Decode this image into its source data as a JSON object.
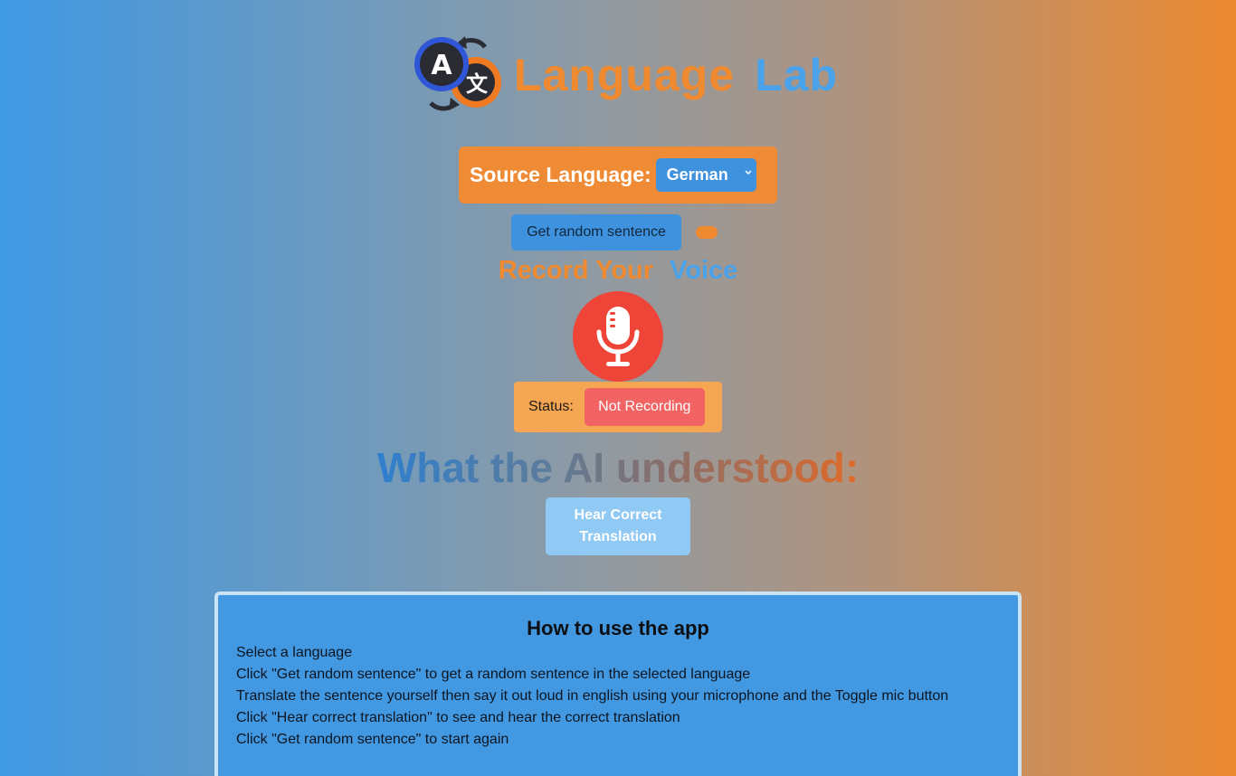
{
  "header": {
    "title_part1": "Language",
    "title_part2": "Lab",
    "logo_icon": "translate-logo-icon",
    "logo_letter_latin": "A",
    "logo_letter_cjk": "文"
  },
  "source": {
    "label": "Source Language:",
    "selected": "German"
  },
  "controls": {
    "random_label": "Get random sentence"
  },
  "record": {
    "title_part1": "Record Your",
    "title_part2": "Voice",
    "mic_icon": "microphone-icon"
  },
  "status": {
    "label": "Status:",
    "value": "Not Recording"
  },
  "result": {
    "title": "What the AI understood:"
  },
  "hear": {
    "label_line1": "Hear Correct",
    "label_line2": "Translation"
  },
  "howto": {
    "title": "How to use the app",
    "steps": [
      "Select a language",
      "Click \"Get random sentence\" to get a random sentence in the selected language",
      "Translate the sentence yourself then say it out loud in english using your microphone and the Toggle mic button",
      "Click \"Hear correct translation\" to see and hear the correct translation",
      "Click \"Get random sentence\" to start again"
    ]
  },
  "colors": {
    "orange": "#ef8a30",
    "blue": "#4aa2ea",
    "mic_red": "#ef4438",
    "status_red": "#f26464"
  }
}
